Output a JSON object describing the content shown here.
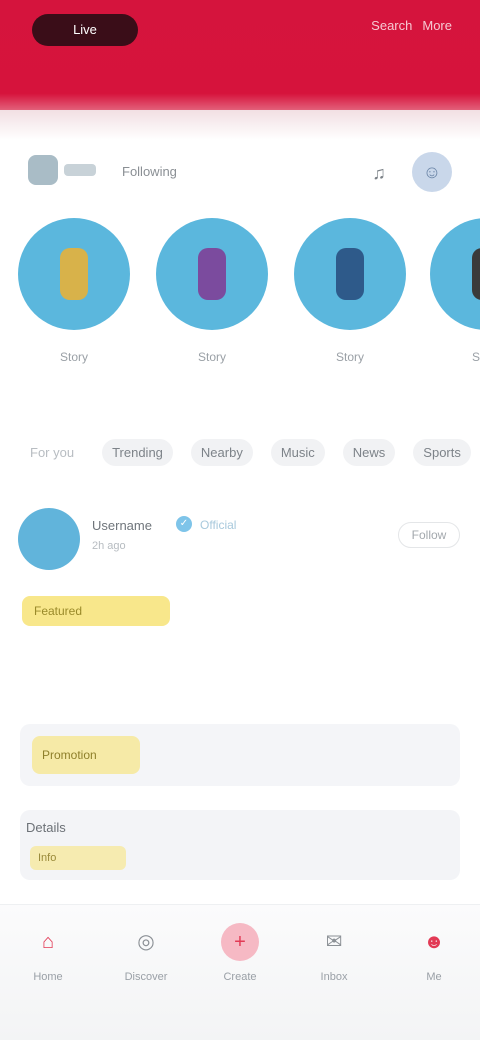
{
  "header": {
    "pill_label": "Live",
    "actions": [
      "Search",
      "More"
    ]
  },
  "top_row": {
    "label": "Following",
    "icon_a": "bell-icon",
    "icon_b": "profile-icon"
  },
  "stories": [
    {
      "name": "Story",
      "sub": "",
      "avatar_color": "#d8b24a"
    },
    {
      "name": "Story",
      "sub": "",
      "avatar_color": "#7b4b9e"
    },
    {
      "name": "Story",
      "sub": "",
      "avatar_color": "#2e5a8a"
    },
    {
      "name": "Story",
      "sub": "",
      "avatar_color": "#3a3a3a"
    }
  ],
  "chips": [
    "For you",
    "Trending",
    "Nearby",
    "Music",
    "News",
    "Sports"
  ],
  "post": {
    "user": "Username",
    "tag": "Official",
    "meta": "2h ago",
    "follow_label": "Follow",
    "badge": "Featured",
    "text_line1": "",
    "text_line2": "",
    "promo_chip": "Promotion",
    "promo_text": "",
    "info_title": "Details",
    "info_chip": "Info",
    "info_line": ""
  },
  "bottom_nav": [
    {
      "label": "Home",
      "icon": "home-icon"
    },
    {
      "label": "Discover",
      "icon": "compass-icon"
    },
    {
      "label": "Create",
      "icon": "plus-icon"
    },
    {
      "label": "Inbox",
      "icon": "message-icon"
    },
    {
      "label": "Me",
      "icon": "user-icon"
    }
  ],
  "colors": {
    "brand_red": "#d5143d",
    "story_ring": "#5bb7dd",
    "badge_yellow": "#f8e78b"
  }
}
